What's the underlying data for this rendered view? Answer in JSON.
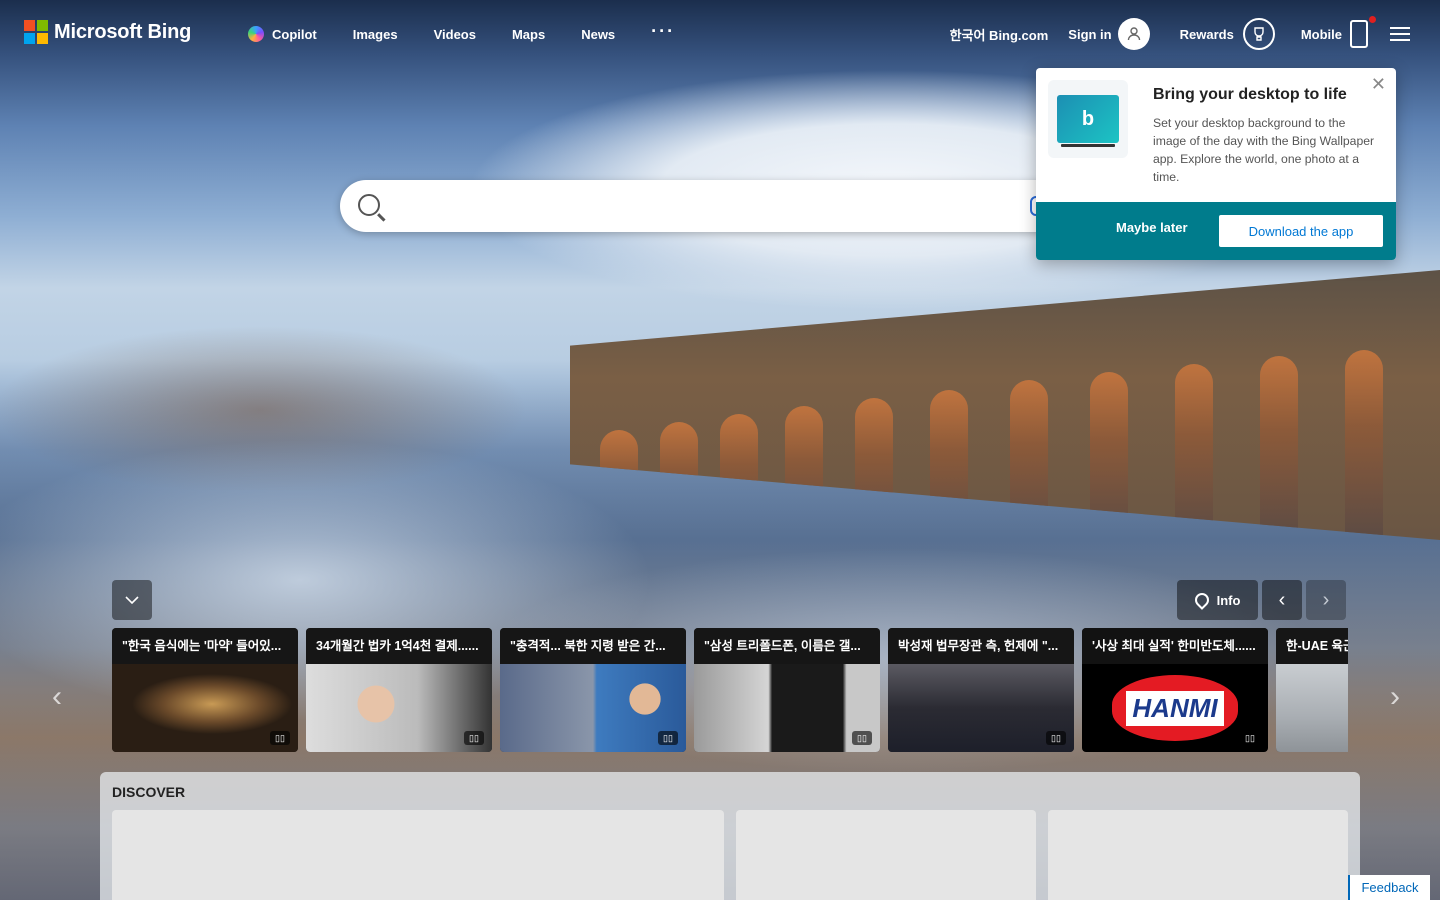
{
  "brand": {
    "name": "Microsoft Bing",
    "logo_colors": [
      "#f25022",
      "#7fba00",
      "#00a4ef",
      "#ffb900"
    ]
  },
  "nav": {
    "items": [
      "Copilot",
      "Images",
      "Videos",
      "Maps",
      "News"
    ],
    "more": "···"
  },
  "header_right": {
    "language": "한국어 Bing.com",
    "signin": "Sign in",
    "rewards": "Rewards",
    "mobile": "Mobile"
  },
  "search": {
    "placeholder": "",
    "value": ""
  },
  "popup": {
    "title": "Bring your desktop to life",
    "body": "Set your desktop background to the image of the day with the Bing Wallpaper app. Explore the world, one photo at a time.",
    "later": "Maybe later",
    "download": "Download the app",
    "close": "✕",
    "footer_color": "#007c8c"
  },
  "carousel": {
    "info": "Info",
    "prev": "‹",
    "next": "›",
    "collapse": "⌄"
  },
  "news": [
    {
      "title": "\"한국 음식에는 '마약' 들어있..."
    },
    {
      "title": "34개월간 법카 1억4천 결제......"
    },
    {
      "title": "\"충격적... 북한 지령 받은 간..."
    },
    {
      "title": "\"삼성 트리폴드폰, 이름은 갤..."
    },
    {
      "title": "박성재 법무장관 측, 헌제에 \"..."
    },
    {
      "title": "'사상 최대 실적' 한미반도체......"
    },
    {
      "title": "한-UAE 육군"
    }
  ],
  "discover": {
    "title": "DISCOVER",
    "feedback": "Feedback"
  },
  "hanmi_logo_text": "HANMI"
}
